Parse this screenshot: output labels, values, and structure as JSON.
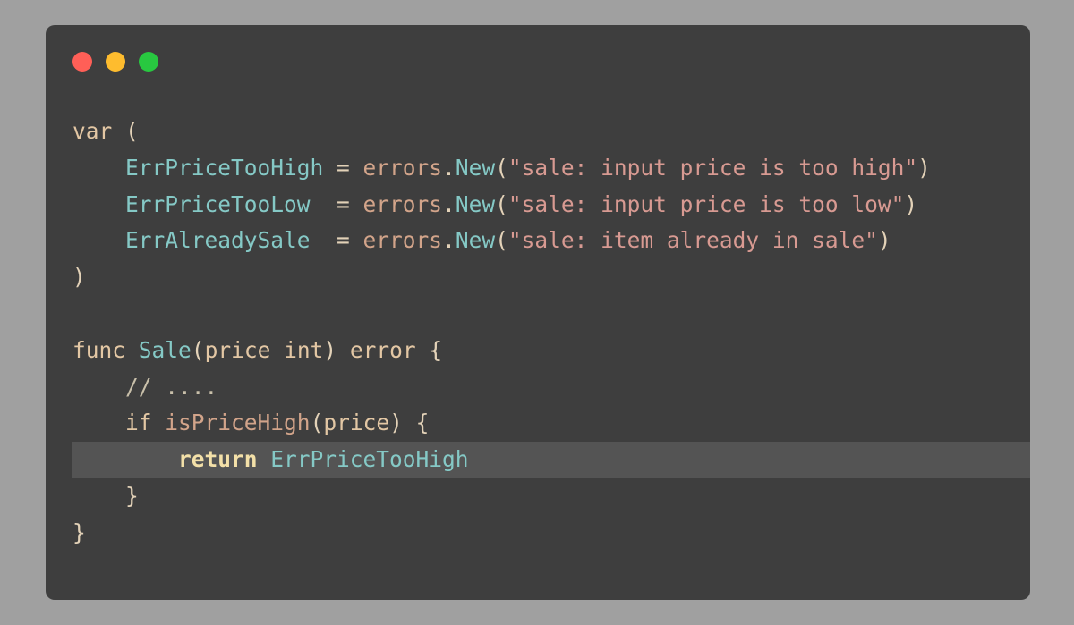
{
  "window": {
    "controls": {
      "close_color": "#ff5f57",
      "minimize_color": "#febc2e",
      "maximize_color": "#28c840"
    }
  },
  "code": {
    "language": "go",
    "highlighted_line": 10,
    "lines": [
      {
        "var_kw": "var",
        "open": " ("
      },
      {
        "indent": "    ",
        "name": "ErrPriceTooHigh",
        "eq": " = ",
        "pkg": "errors",
        "dot": ".",
        "fn": "New",
        "lp": "(",
        "str": "\"sale: input price is too high\"",
        "rp": ")"
      },
      {
        "indent": "    ",
        "name": "ErrPriceTooLow",
        "eq": "  = ",
        "pkg": "errors",
        "dot": ".",
        "fn": "New",
        "lp": "(",
        "str": "\"sale: input price is too low\"",
        "rp": ")"
      },
      {
        "indent": "    ",
        "name": "ErrAlreadySale",
        "eq": "  = ",
        "pkg": "errors",
        "dot": ".",
        "fn": "New",
        "lp": "(",
        "str": "\"sale: item already in sale\"",
        "rp": ")"
      },
      {
        "close": ")"
      },
      {},
      {
        "func_kw": "func",
        "sp": " ",
        "fname": "Sale",
        "lp": "(",
        "param": "price",
        "sp2": " ",
        "ptype": "int",
        "rp": ")",
        "sp3": " ",
        "rtype": "error",
        "brace": " {"
      },
      {
        "indent": "    ",
        "comment": "// ...."
      },
      {
        "indent": "    ",
        "if_kw": "if",
        "sp": " ",
        "call": "isPriceHigh",
        "lp": "(",
        "arg": "price",
        "rp": ")",
        "brace": " {"
      },
      {
        "indent": "        ",
        "ret_kw": "return",
        "sp": " ",
        "ret_val": "ErrPriceTooHigh"
      },
      {
        "indent": "    ",
        "close": "}"
      },
      {
        "close": "}"
      }
    ]
  }
}
